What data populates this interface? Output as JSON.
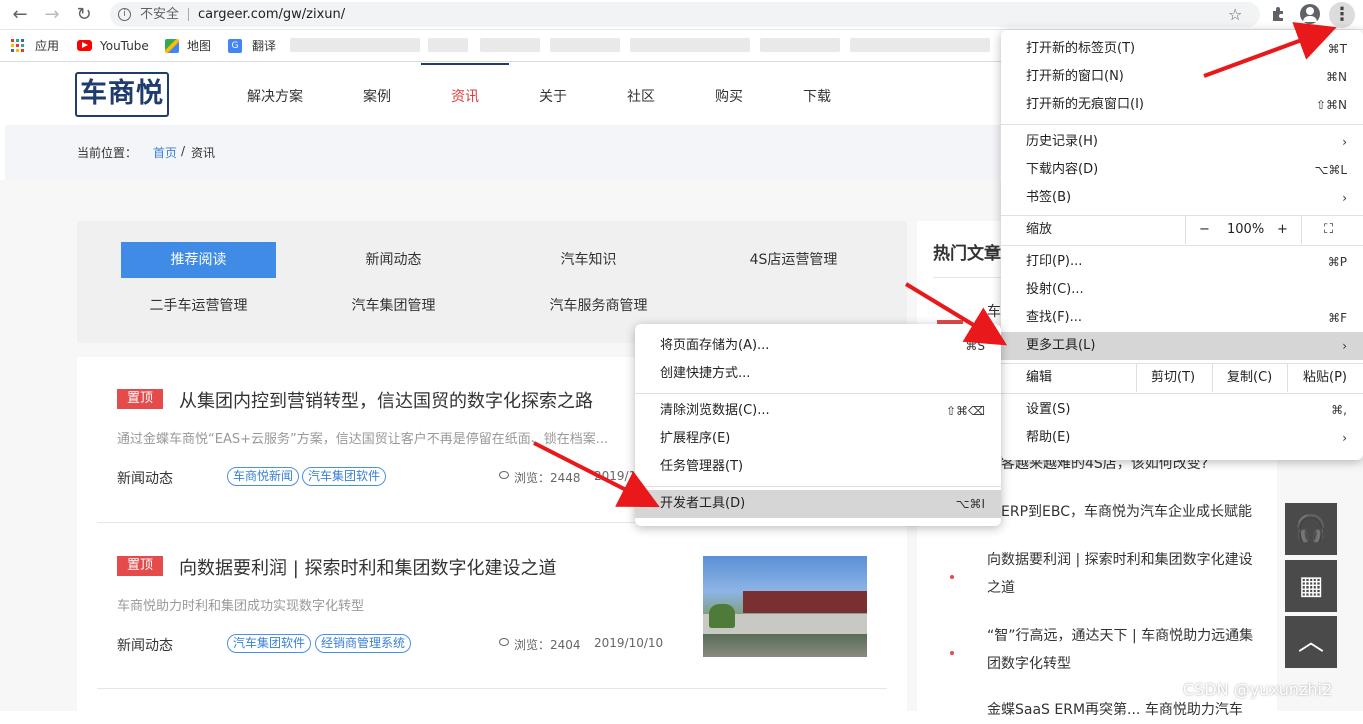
{
  "browser": {
    "back": "←",
    "forward": "→",
    "reload": "↻",
    "security": "不安全",
    "url": "cargeer.com/gw/zixun/",
    "star": "☆",
    "menu": "⋮",
    "bookmarks": [
      {
        "label": "应用"
      },
      {
        "label": "YouTube"
      },
      {
        "label": "地图"
      },
      {
        "label": "翻译"
      }
    ]
  },
  "site": {
    "logo": "车商悦",
    "nav": [
      "解决方案",
      "案例",
      "资讯",
      "关于",
      "社区",
      "购买",
      "下载"
    ],
    "active_nav": "资讯",
    "breadcrumb": {
      "label": "当前位置：",
      "home": "首页",
      "sep": "/",
      "current": "资讯"
    }
  },
  "tabs": {
    "row1": [
      "推荐阅读",
      "新闻动态",
      "汽车知识",
      "4S店运营管理"
    ],
    "row2": [
      "二手车运营管理",
      "汽车集团管理",
      "汽车服务商管理"
    ]
  },
  "articles": [
    {
      "badge": "置顶",
      "title": "从集团内控到营销转型，信达国贸的数字化探索之路",
      "desc": "通过金蝶车商悦“EAS+云服务”方案，信达国贸让客户不再是停留在纸面、锁在档案...",
      "category": "新闻动态",
      "tags": [
        "车商悦新闻",
        "汽车集团软件"
      ],
      "views": "浏览：2448",
      "date": "2019/11"
    },
    {
      "badge": "置顶",
      "title": "向数据要利润 | 探索时利和集团数字化建设之道",
      "desc": "车商悦助力时利和集团成功实现数字化转型",
      "category": "新闻动态",
      "tags": [
        "汽车集团软件",
        "经销商管理系统"
      ],
      "views": "浏览：2404",
      "date": "2019/10/10"
    }
  ],
  "hot": {
    "title": "热门文章",
    "items": [
      "车",
      "客越来越难的4S店，该如何改变?",
      "ERP到EBC，车商悦为汽车企业成长赋能",
      "向数据要利润 | 探索时利和集团数字化建设之道",
      "“智”行高远，通达天下 | 车商悦助力远通集团数字化转型",
      "金蝶SaaS ERM再突第... 车商悦助力汽车"
    ]
  },
  "chrome_menu": {
    "items": [
      {
        "label": "打开新的标签页(T)",
        "shortcut": "⌘T"
      },
      {
        "label": "打开新的窗口(N)",
        "shortcut": "⌘N"
      },
      {
        "label": "打开新的无痕窗口(I)",
        "shortcut": "⇧⌘N"
      },
      {
        "label": "历史记录(H)",
        "shortcut": "›"
      },
      {
        "label": "下载内容(D)",
        "shortcut": "⌥⌘L"
      },
      {
        "label": "书签(B)",
        "shortcut": "›"
      },
      {
        "label": "打印(P)...",
        "shortcut": "⌘P"
      },
      {
        "label": "投射(C)...",
        "shortcut": ""
      },
      {
        "label": "查找(F)...",
        "shortcut": "⌘F"
      },
      {
        "label": "更多工具(L)",
        "shortcut": "›"
      },
      {
        "label": "设置(S)",
        "shortcut": "⌘,"
      },
      {
        "label": "帮助(E)",
        "shortcut": "›"
      }
    ],
    "zoom": {
      "label": "缩放",
      "minus": "−",
      "value": "100%",
      "plus": "+",
      "fullscreen": "⛶"
    },
    "edit": {
      "label": "编辑",
      "cut": "剪切(T)",
      "copy": "复制(C)",
      "paste": "粘贴(P)"
    }
  },
  "more_tools_menu": {
    "items": [
      {
        "label": "将页面存储为(A)...",
        "shortcut": "⌘S"
      },
      {
        "label": "创建快捷方式...",
        "shortcut": ""
      },
      {
        "label": "清除浏览数据(C)...",
        "shortcut": "⇧⌘⌫"
      },
      {
        "label": "扩展程序(E)",
        "shortcut": ""
      },
      {
        "label": "任务管理器(T)",
        "shortcut": ""
      },
      {
        "label": "开发者工具(D)",
        "shortcut": "⌥⌘I"
      }
    ]
  },
  "side_buttons": {
    "support": "🎧",
    "qrcode": "▦",
    "top": "︿"
  },
  "watermark": "CSDN @yuxunzhi2",
  "colors": {
    "accent": "#3f8be6",
    "red": "#e54b4b",
    "nav_active": "#e03c3c",
    "arrow": "#e8181b"
  }
}
